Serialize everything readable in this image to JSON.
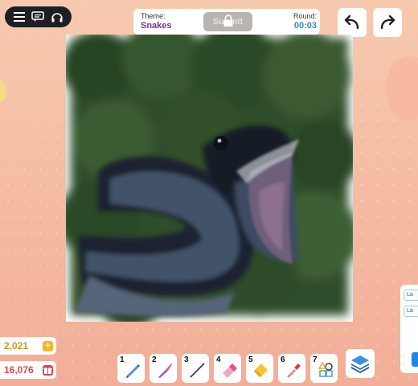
{
  "header": {
    "theme_label": "Theme:",
    "theme_value": "Snakes",
    "submit_label": "Submit",
    "round_label": "Round:",
    "round_value": "00:03"
  },
  "history": {
    "undo_key": "Z",
    "redo_key": "Y"
  },
  "stats": {
    "coins": "2,021",
    "coins_action": "+",
    "gems": "16,076"
  },
  "tools": [
    {
      "key": "1",
      "icon": "pen-icon"
    },
    {
      "key": "2",
      "icon": "brush-icon"
    },
    {
      "key": "3",
      "icon": "line-icon"
    },
    {
      "key": "4",
      "icon": "eraser-icon"
    },
    {
      "key": "5",
      "icon": "fill-bucket-icon"
    },
    {
      "key": "6",
      "icon": "eyedropper-icon"
    },
    {
      "key": "7",
      "icon": "shapes-icon"
    }
  ],
  "side_panel": {
    "items": [
      "La",
      "La"
    ]
  },
  "colors": {
    "theme_purple": "#7a2e9a",
    "round_blue": "#2a8fb9",
    "coin_gold": "#c99a14",
    "gem_red": "#e0434b"
  }
}
